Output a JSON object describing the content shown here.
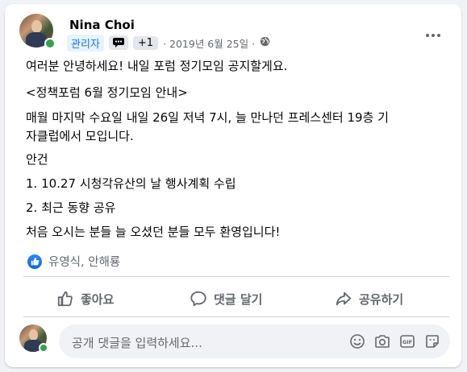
{
  "post": {
    "author_name": "Nina Choi",
    "role_badge": "관리자",
    "extra_badges": "+1",
    "date": "· 2019년 6월 25일 ·",
    "lines": [
      "여러분 안녕하세요! 내일 포럼 정기모임 공지할게요.",
      "<정책포럼 6월 정기모임 안내>",
      "매월 마지막 수요일 내일 26일 저녁 7시, 늘 만나던 프레스센터 19층 기",
      "자클럽에서 모입니다.",
      "안건",
      "1. 10.27 시청각유산의 날 행사계획 수립",
      "2. 최근 동향 공유",
      "처음 오시는 분들 늘 오셨던 분들 모두 환영입니다!"
    ]
  },
  "reactions": {
    "names": "유영식, 안해룡"
  },
  "actions": {
    "like": "좋아요",
    "comment": "댓글 달기",
    "share": "공유하기"
  },
  "comment": {
    "placeholder": "공개 댓글을 입력하세요..."
  },
  "colors": {
    "accent": "#1b74e4",
    "online": "#31a24c",
    "muted": "#65676b"
  }
}
